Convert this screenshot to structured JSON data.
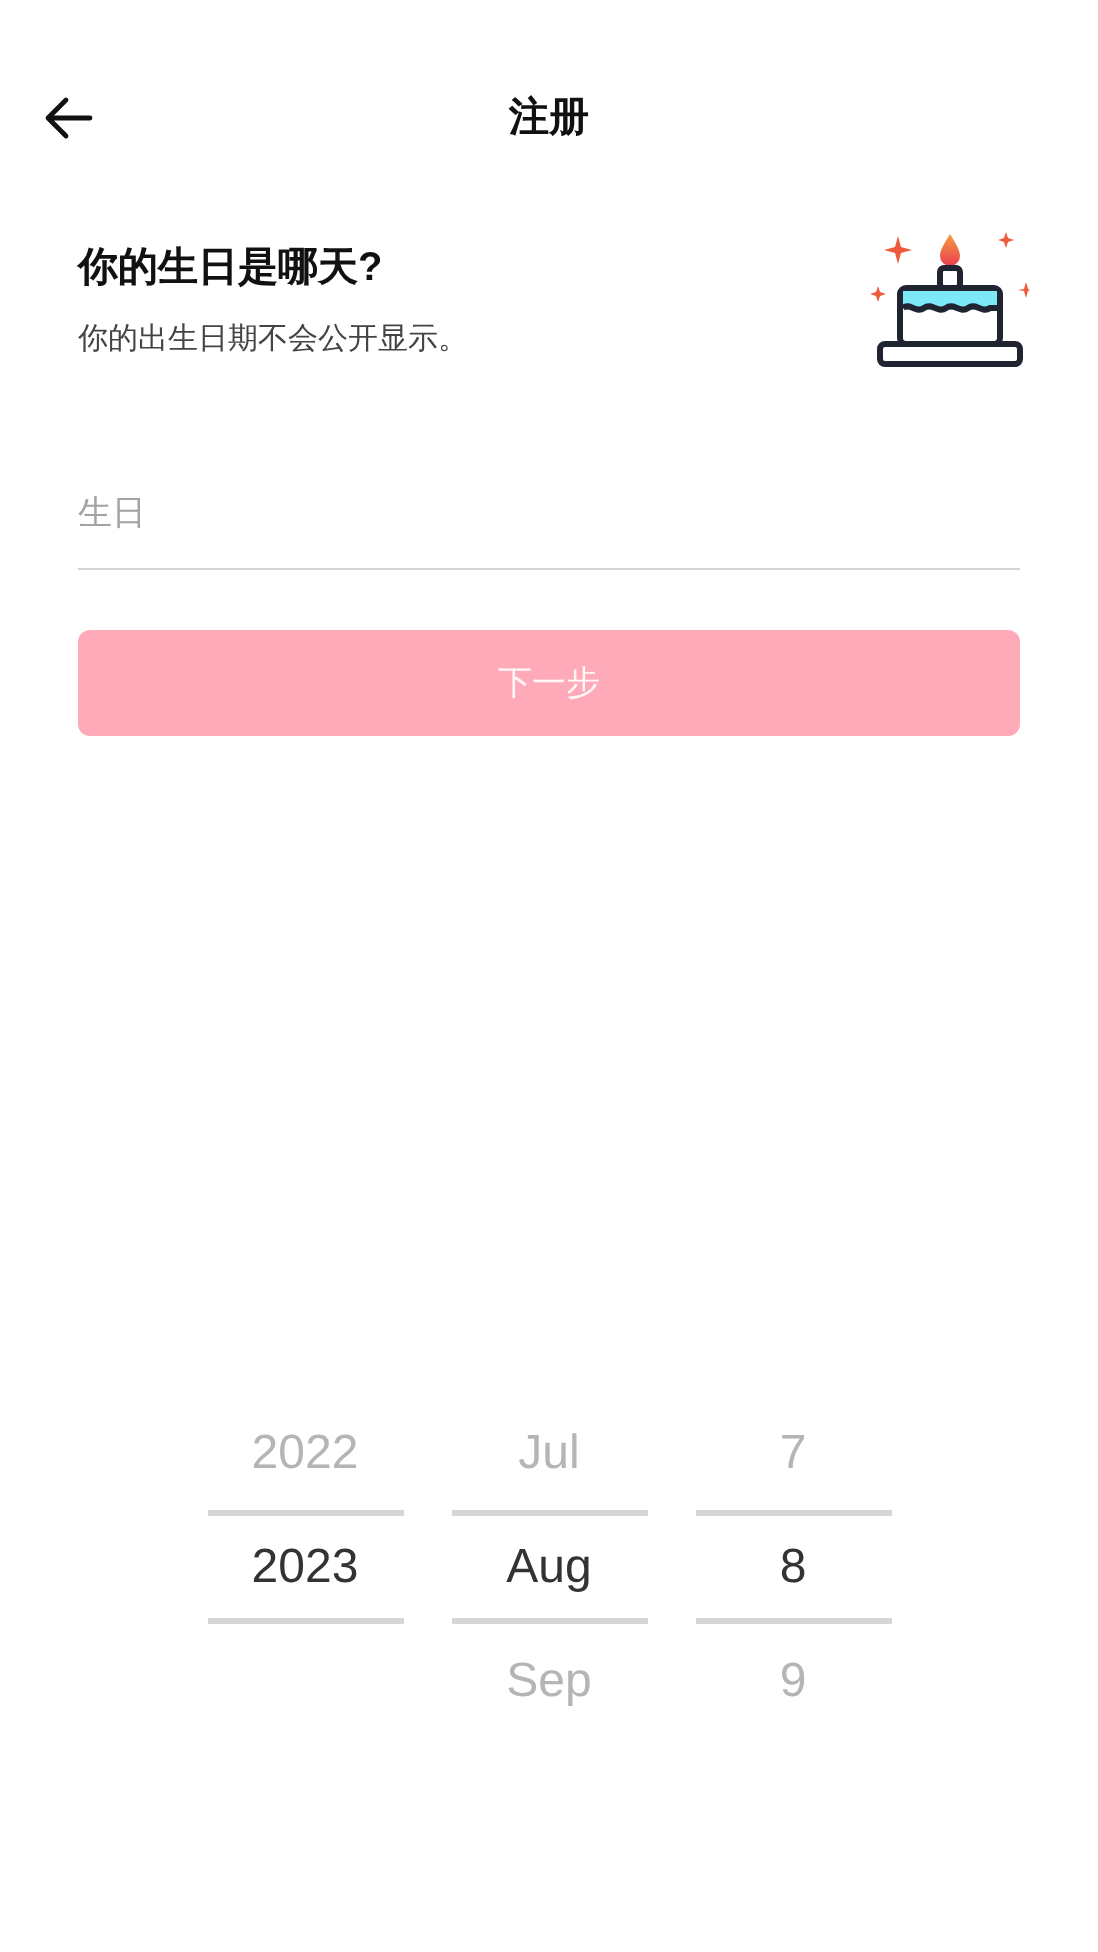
{
  "header": {
    "title": "注册"
  },
  "heading": "你的生日是哪天?",
  "subtitle": "你的出生日期不会公开显示。",
  "birthday_field": {
    "placeholder": "生日"
  },
  "next_button": {
    "label": "下一步",
    "disabled": true
  },
  "date_picker": [
    {
      "items": [
        {
          "label": "2022",
          "selected": false
        },
        {
          "label": "2023",
          "selected": true
        }
      ]
    },
    {
      "items": [
        {
          "label": "Jul",
          "selected": false
        },
        {
          "label": "Aug",
          "selected": true
        },
        {
          "label": "Sep",
          "selected": false
        }
      ]
    },
    {
      "items": [
        {
          "label": "7",
          "selected": false
        },
        {
          "label": "8",
          "selected": true
        },
        {
          "label": "9",
          "selected": false
        }
      ]
    }
  ]
}
